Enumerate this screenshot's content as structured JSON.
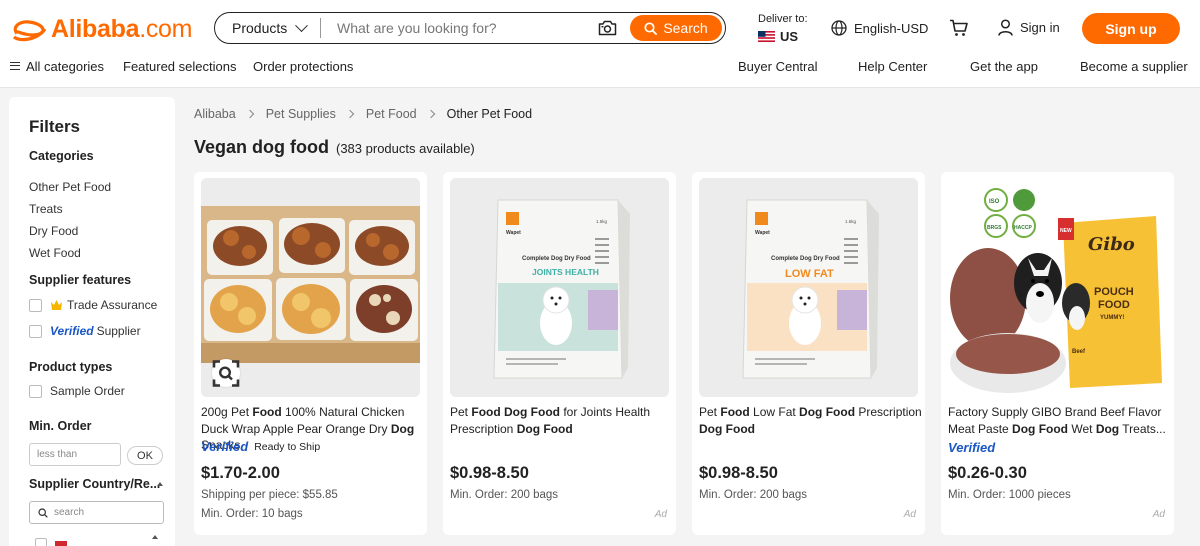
{
  "header": {
    "logo_text": "Alibaba",
    "logo_suffix": ".com",
    "search": {
      "category": "Products",
      "placeholder": "What are you looking for?",
      "button_label": "Search"
    },
    "deliver": {
      "label": "Deliver to:",
      "country": "US"
    },
    "language": "English-USD",
    "sign_in": "Sign in",
    "sign_up": "Sign up"
  },
  "subnav": {
    "left": [
      "All categories",
      "Featured selections",
      "Order protections"
    ],
    "right": [
      "Buyer Central",
      "Help Center",
      "Get the app",
      "Become a supplier"
    ]
  },
  "filters": {
    "title": "Filters",
    "categories_heading": "Categories",
    "categories": [
      "Other Pet Food",
      "Treats",
      "Dry Food",
      "Wet Food"
    ],
    "supplier_features_heading": "Supplier features",
    "trade_assurance": "Trade Assurance",
    "verified_word": "Verified",
    "verified_supplier": "Supplier",
    "product_types_heading": "Product types",
    "sample_order": "Sample Order",
    "min_order_heading": "Min. Order",
    "min_order_placeholder": "less than",
    "ok_label": "OK",
    "country_heading": "Supplier Country/Re...",
    "country_search_placeholder": "search"
  },
  "breadcrumb": [
    "Alibaba",
    "Pet Supplies",
    "Pet Food",
    "Other Pet Food"
  ],
  "page": {
    "title": "Vegan dog food",
    "count": "(383 products available)"
  },
  "products": [
    {
      "title_parts": [
        {
          "t": "200g Pet ",
          "b": false
        },
        {
          "t": "Food",
          "b": true
        },
        {
          "t": " 100% Natural Chicken Duck Wrap Apple Pear Orange Dry ",
          "b": false
        },
        {
          "t": "Dog",
          "b": true
        },
        {
          "t": " Snacks",
          "b": false
        }
      ],
      "verified": "Verified",
      "ready_to_ship": "Ready to Ship",
      "price": "$1.70-2.00",
      "line1": "Shipping per piece: $55.85",
      "line2": "Min. Order: 10 bags",
      "ad": ""
    },
    {
      "title_parts": [
        {
          "t": "Pet ",
          "b": false
        },
        {
          "t": "Food Dog Food",
          "b": true
        },
        {
          "t": " for Joints Health Prescription ",
          "b": false
        },
        {
          "t": "Dog Food",
          "b": true
        }
      ],
      "verified": "",
      "ready_to_ship": "",
      "price": "$0.98-8.50",
      "line1": "Min. Order: 200 bags",
      "line2": "",
      "ad": "Ad",
      "bag_brand": "Wapet",
      "bag_line1": "Complete Dog Dry Food",
      "bag_line2": "JOINTS HEALTH",
      "bag_weight": "1.5kg"
    },
    {
      "title_parts": [
        {
          "t": "Pet ",
          "b": false
        },
        {
          "t": "Food",
          "b": true
        },
        {
          "t": " Low Fat ",
          "b": false
        },
        {
          "t": "Dog Food",
          "b": true
        },
        {
          "t": " Prescription ",
          "b": false
        },
        {
          "t": "Dog Food",
          "b": true
        }
      ],
      "verified": "",
      "ready_to_ship": "",
      "price": "$0.98-8.50",
      "line1": "Min. Order: 200 bags",
      "line2": "",
      "ad": "Ad",
      "bag_brand": "Wapet",
      "bag_line1": "Complete Dog Dry Food",
      "bag_line2": "LOW FAT",
      "bag_weight": "1.5kg"
    },
    {
      "title_parts": [
        {
          "t": "Factory Supply GIBO Brand Beef Flavor Meat Paste ",
          "b": false
        },
        {
          "t": "Dog Food",
          "b": true
        },
        {
          "t": " Wet ",
          "b": false
        },
        {
          "t": "Dog",
          "b": true
        },
        {
          "t": " Treats...",
          "b": false
        }
      ],
      "verified": "Verified",
      "ready_to_ship": "",
      "price": "$0.26-0.30",
      "line1": "Min. Order: 1000 pieces",
      "line2": "",
      "ad": "Ad",
      "pouch_brand": "Gibo",
      "pouch_line1": "POUCH",
      "pouch_line2": "FOOD",
      "pouch_line3": "YUMMY!",
      "pouch_new": "NEW",
      "pouch_flavor": "Beef",
      "cert_iso": "ISO",
      "cert_brcs": "BRGS",
      "cert_haccp": "HACCP"
    }
  ],
  "colors": {
    "brand_orange": "#ff6a00",
    "verified_blue": "#1a56c4",
    "page_bg": "#f4f4f4"
  }
}
